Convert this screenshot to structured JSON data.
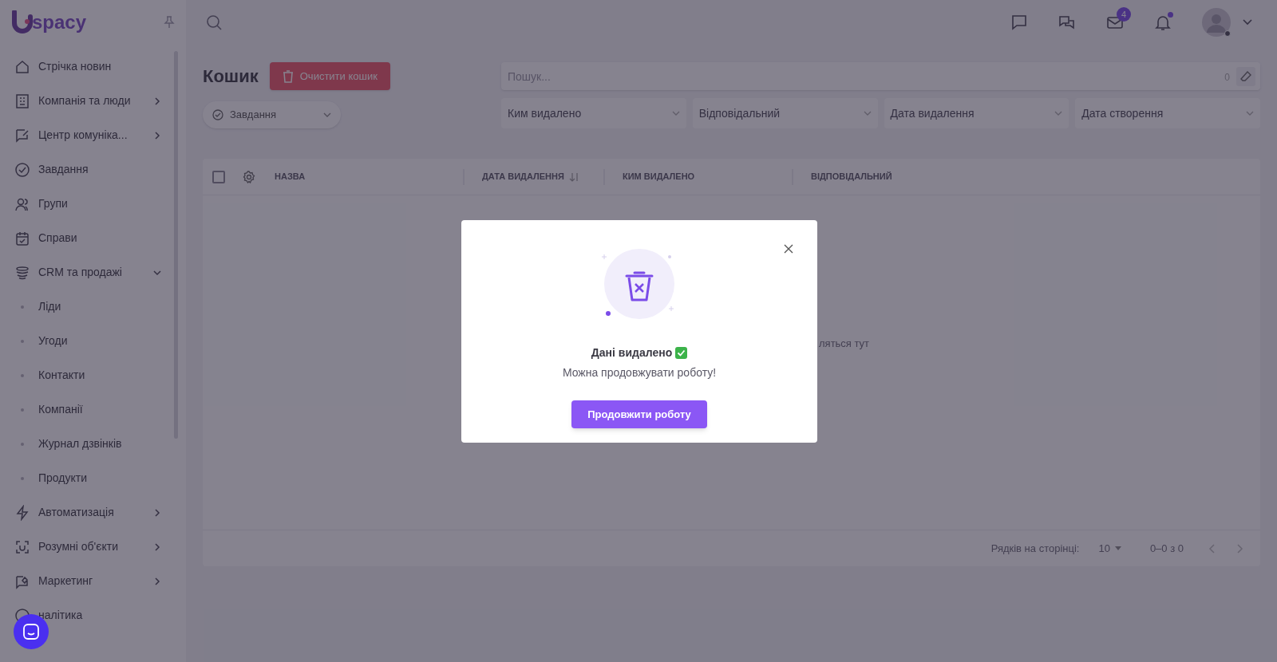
{
  "logo": {
    "text": "spacy"
  },
  "sidebar": {
    "items": [
      {
        "label": "Стрічка новин",
        "kind": "link"
      },
      {
        "label": "Компанія та люди",
        "kind": "group",
        "expanded": false
      },
      {
        "label": "Центр комуніка...",
        "kind": "group",
        "expanded": false
      },
      {
        "label": "Завдання",
        "kind": "link"
      },
      {
        "label": "Групи",
        "kind": "link"
      },
      {
        "label": "Справи",
        "kind": "link"
      },
      {
        "label": "CRM та продажі",
        "kind": "group",
        "expanded": true,
        "children": [
          {
            "label": "Ліди"
          },
          {
            "label": "Угоди"
          },
          {
            "label": "Контакти"
          },
          {
            "label": "Компанії"
          },
          {
            "label": "Журнал дзвінків"
          },
          {
            "label": "Продукти"
          }
        ]
      },
      {
        "label": "Автоматизація",
        "kind": "group",
        "expanded": false
      },
      {
        "label": "Розумні об'єкти",
        "kind": "group",
        "expanded": false
      },
      {
        "label": "Маркетинг",
        "kind": "group",
        "expanded": false
      },
      {
        "label": "налітика",
        "kind": "link"
      }
    ]
  },
  "header": {
    "mail_badge": "4",
    "notifications_unread": true
  },
  "page": {
    "title": "Кошик",
    "clear_button": "Очистити кошик",
    "entity_select": "Завдання",
    "search": {
      "placeholder": "Пошук...",
      "count": "0"
    },
    "filters": [
      "Ким видалено",
      "Відповідальний",
      "Дата видалення",
      "Дата створення"
    ]
  },
  "table": {
    "columns": [
      {
        "label": "НАЗВА",
        "sorted": false
      },
      {
        "label": "ДАТА ВИДАЛЕННЯ",
        "sorted": true
      },
      {
        "label": "КИМ ВИДАЛЕНО",
        "sorted": false
      },
      {
        "label": "ВІДПОВІДАЛЬНИЙ",
        "sorted": false
      }
    ],
    "select_all_checked": false,
    "empty_text": "ляться тут",
    "footer": {
      "rows_label": "Рядків на сторінці:",
      "rows_value": "10",
      "range": "0–0 з 0"
    }
  },
  "dialog": {
    "title": "Дані видалено",
    "message": "Можна продовжувати роботу!",
    "button": "Продовжити роботу"
  }
}
